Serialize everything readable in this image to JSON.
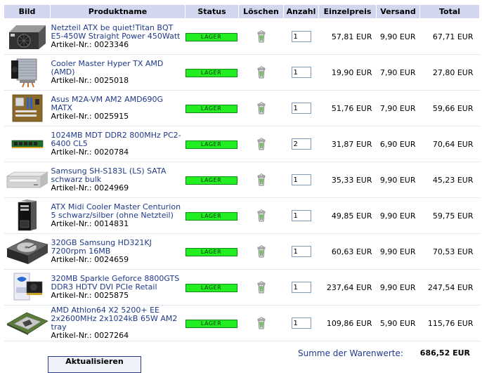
{
  "headers": {
    "bild": "Bild",
    "produktname": "Produktname",
    "status": "Status",
    "loeschen": "Löschen",
    "anzahl": "Anzahl",
    "einzelpreis": "Einzelpreis",
    "versand": "Versand",
    "total": "Total"
  },
  "items": [
    {
      "name": "Netzteil ATX be quiet!Titan BQT E5-450W Straight Power 450Watt",
      "artikel": "Artikel-Nr.: 0023346",
      "status": "LAGER",
      "anzahl": "1",
      "einzelpreis": "57,81 EUR",
      "versand": "9,90 EUR",
      "total": "67,71 EUR",
      "image": "psu-image"
    },
    {
      "name": "Cooler Master Hyper TX AMD (AMD)",
      "artikel": "Artikel-Nr.: 0025018",
      "status": "LAGER",
      "anzahl": "1",
      "einzelpreis": "19,90 EUR",
      "versand": "7,90 EUR",
      "total": "27,80 EUR",
      "image": "cpu-cooler-image"
    },
    {
      "name": "Asus M2A-VM AM2 AMD690G MATX",
      "artikel": "Artikel-Nr.: 0025915",
      "status": "LAGER",
      "anzahl": "1",
      "einzelpreis": "51,76 EUR",
      "versand": "7,90 EUR",
      "total": "59,66 EUR",
      "image": "motherboard-image"
    },
    {
      "name": "1024MB MDT DDR2 800MHz PC2-6400 CL5",
      "artikel": "Artikel-Nr.: 0020784",
      "status": "LAGER",
      "anzahl": "2",
      "einzelpreis": "31,87 EUR",
      "versand": "6,90 EUR",
      "total": "70,64 EUR",
      "image": "ram-image"
    },
    {
      "name": "Samsung SH-S183L (LS) SATA schwarz bulk",
      "artikel": "Artikel-Nr.: 0024969",
      "status": "LAGER",
      "anzahl": "1",
      "einzelpreis": "35,33 EUR",
      "versand": "9,90 EUR",
      "total": "45,23 EUR",
      "image": "dvd-drive-image"
    },
    {
      "name": "ATX Midi Cooler Master Centurion 5 schwarz/silber (ohne Netzteil)",
      "artikel": "Artikel-Nr.: 0014831",
      "status": "LAGER",
      "anzahl": "1",
      "einzelpreis": "49,85 EUR",
      "versand": "9,90 EUR",
      "total": "59,75 EUR",
      "image": "case-image"
    },
    {
      "name": "320GB Samsung HD321KJ 7200rpm 16MB",
      "artikel": "Artikel-Nr.: 0024659",
      "status": "LAGER",
      "anzahl": "1",
      "einzelpreis": "60,63 EUR",
      "versand": "9,90 EUR",
      "total": "70,53 EUR",
      "image": "hdd-image"
    },
    {
      "name": "320MB Sparkle Geforce 8800GTS DDR3 HDTV DVI PCIe Retail",
      "artikel": "Artikel-Nr.: 0025875",
      "status": "LAGER",
      "anzahl": "1",
      "einzelpreis": "237,64 EUR",
      "versand": "9,90 EUR",
      "total": "247,54 EUR",
      "image": "gpu-image"
    },
    {
      "name": "AMD Athlon64 X2 5200+ EE 2x2600MHz 2x1024kB 65W AM2 tray",
      "artikel": "Artikel-Nr.: 0027264",
      "status": "LAGER",
      "anzahl": "1",
      "einzelpreis": "109,86 EUR",
      "versand": "5,90 EUR",
      "total": "115,76 EUR",
      "image": "cpu-image"
    }
  ],
  "summary": {
    "label": "Summe der Warenwerte:",
    "value": "686,52 EUR"
  },
  "update_button": "Aktualisieren",
  "colors": {
    "header_bg": "#d2d7ef",
    "link": "#1f3a8a",
    "status_green": "#22ee22"
  }
}
